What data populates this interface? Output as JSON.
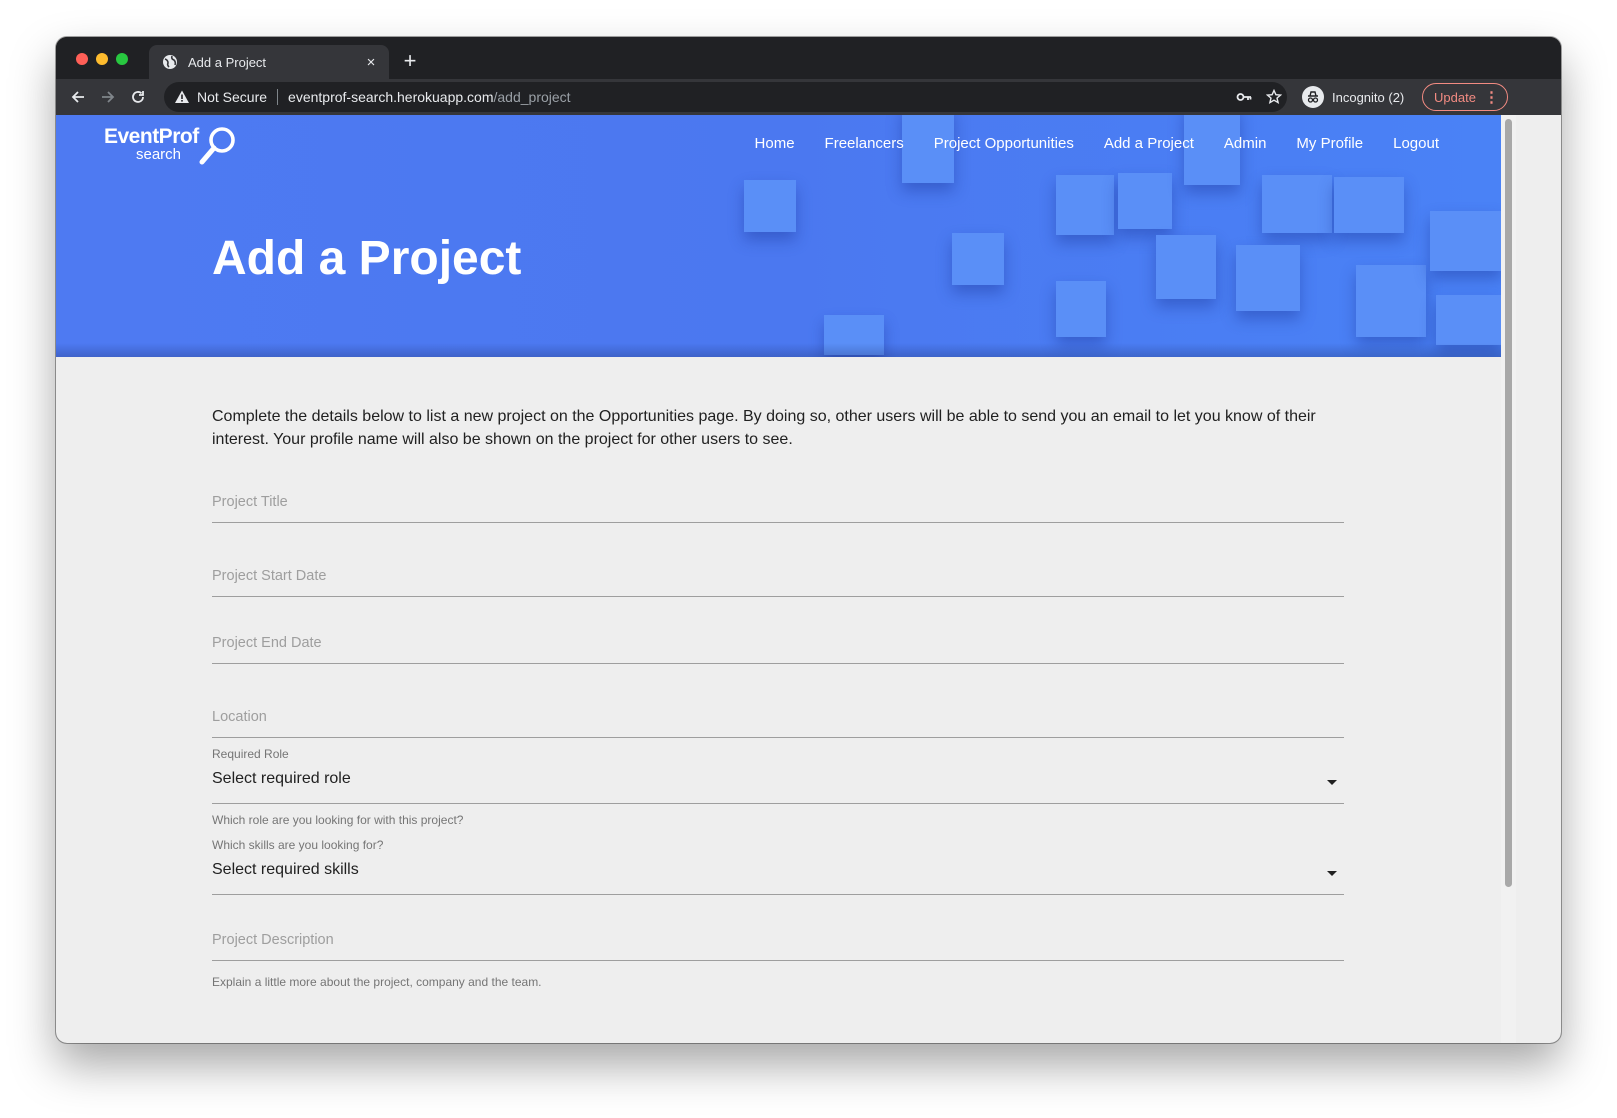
{
  "browser": {
    "tab_title": "Add a Project",
    "tab_close": "×",
    "new_tab": "+",
    "security_label": "Not Secure",
    "url_host": "eventprof-search.herokuapp.com",
    "url_path": "/add_project",
    "incognito_label": "Incognito (2)",
    "update_label": "Update",
    "menu_dots": "⋮"
  },
  "site": {
    "logo_main": "EventProf",
    "logo_sub": "search",
    "nav": [
      "Home",
      "Freelancers",
      "Project Opportunities",
      "Add a Project",
      "Admin",
      "My Profile",
      "Logout"
    ],
    "page_title": "Add a Project",
    "accent_color": "#4e7af2"
  },
  "form": {
    "intro": "Complete the details below to list a new project on the Opportunities page. By doing so, other users will be able to send you an email to let you know of their interest. Your profile name will also be shown on the project for other users to see.",
    "project_title_label": "Project Title",
    "start_date_label": "Project Start Date",
    "end_date_label": "Project End Date",
    "location_label": "Location",
    "role_label": "Required Role",
    "role_value": "Select required role",
    "role_helper": "Which role are you looking for with this project?",
    "skills_label": "Which skills are you looking for?",
    "skills_value": "Select required skills",
    "description_label": "Project Description",
    "description_helper": "Explain a little more about the project, company and the team."
  }
}
